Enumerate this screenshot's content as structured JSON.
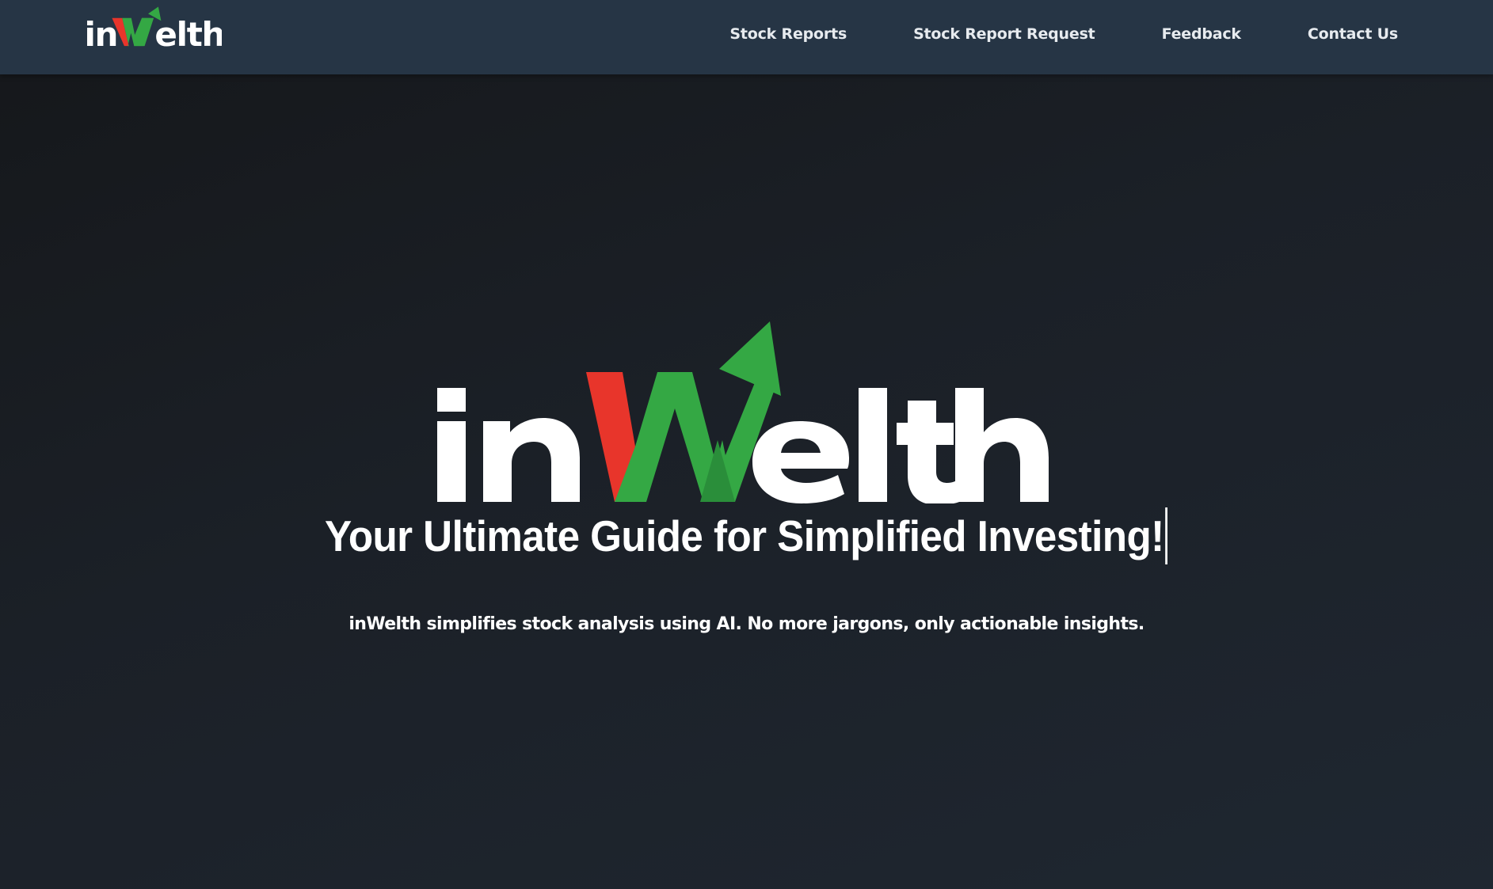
{
  "brand": {
    "name": "inWelth",
    "logo_text_before": "in",
    "logo_text_mark": "W",
    "logo_text_after": "elth",
    "colors": {
      "red": "#e8352b",
      "green": "#34a844",
      "white": "#ffffff",
      "navbar": "#263545"
    }
  },
  "nav": {
    "items": [
      {
        "label": "Stock Reports"
      },
      {
        "label": "Stock Report Request"
      },
      {
        "label": "Feedback"
      },
      {
        "label": "Contact Us"
      }
    ]
  },
  "hero": {
    "title": "Your Ultimate Guide for Simplified Investing!",
    "subtitle": "inWelth simplifies stock analysis using AI. No more jargons, only actionable insights."
  },
  "icons": {
    "logo_mark": "arrow-up-w-icon"
  }
}
